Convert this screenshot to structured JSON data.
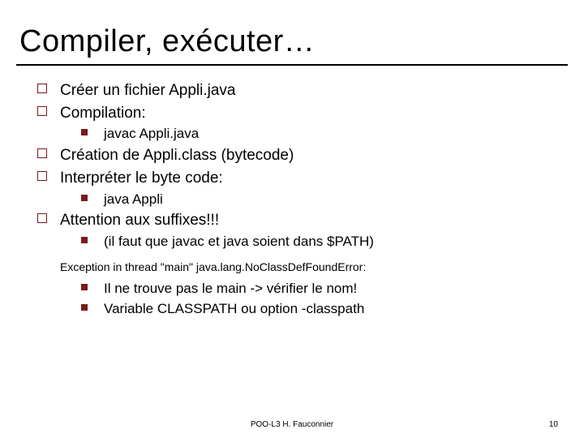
{
  "title": "Compiler, exécuter…",
  "items": {
    "l1_0": "Créer un fichier Appli.java",
    "l1_1": "Compilation:",
    "l2_0": "javac Appli.java",
    "l1_2": "Création de Appli.class (bytecode)",
    "l1_3": "Interpréter le byte code:",
    "l2_1": "java Appli",
    "l1_4": "Attention aux suffixes!!!",
    "l2_2": "(il faut que javac et java soient dans $PATH)",
    "exception": "Exception in thread \"main\" java.lang.NoClassDefFoundError:",
    "l2_3": "Il ne trouve pas le main -> vérifier le nom!",
    "l2_4": "Variable CLASSPATH ou option -classpath"
  },
  "footer": {
    "center": "POO-L3 H. Fauconnier",
    "page": "10"
  }
}
